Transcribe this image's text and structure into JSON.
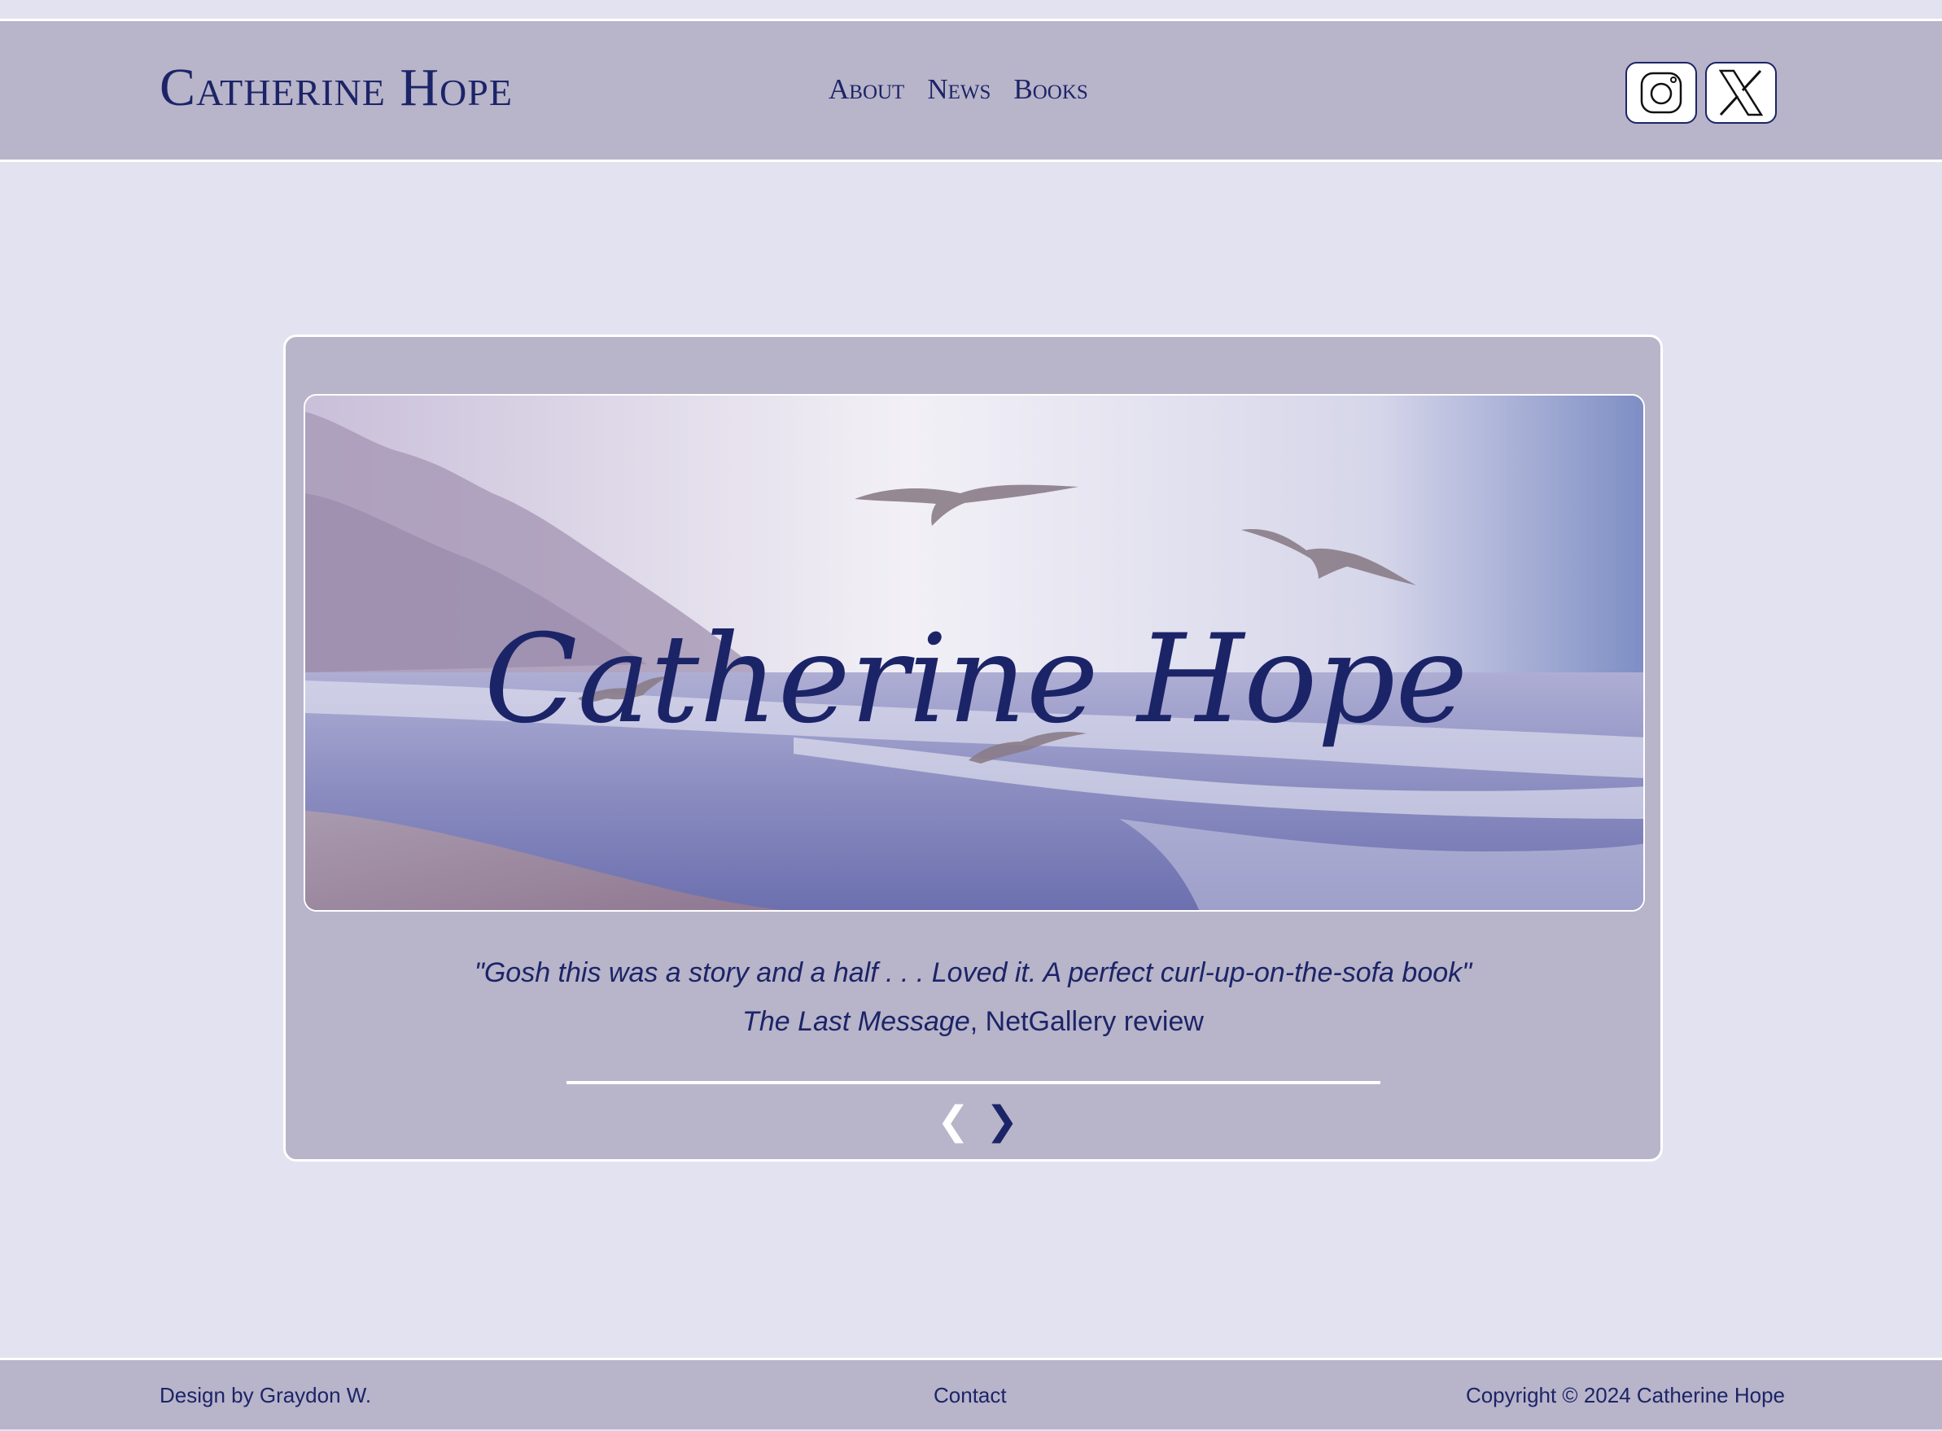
{
  "header": {
    "site_title": "Catherine Hope",
    "nav": [
      {
        "label": "About"
      },
      {
        "label": "News"
      },
      {
        "label": "Books"
      }
    ],
    "social": [
      {
        "icon": "instagram-icon"
      },
      {
        "icon": "x-twitter-icon"
      }
    ]
  },
  "carousel": {
    "banner_script_text": "Catherine Hope",
    "quote": "\"Gosh this was a story and a half . . . Loved it. A perfect curl-up-on-the-sofa book\"",
    "source_title": "The Last Message",
    "source_rest": ", NetGallery review",
    "prev_arrow": "❮",
    "next_arrow": "❯"
  },
  "footer": {
    "credit": "Design by Graydon W.",
    "contact": "Contact",
    "copyright": "Copyright © 2024 Catherine Hope"
  },
  "colors": {
    "background": "#e3e2f1",
    "panel": "#b8b4c9",
    "text": "#1c2468",
    "border": "#ffffff"
  }
}
